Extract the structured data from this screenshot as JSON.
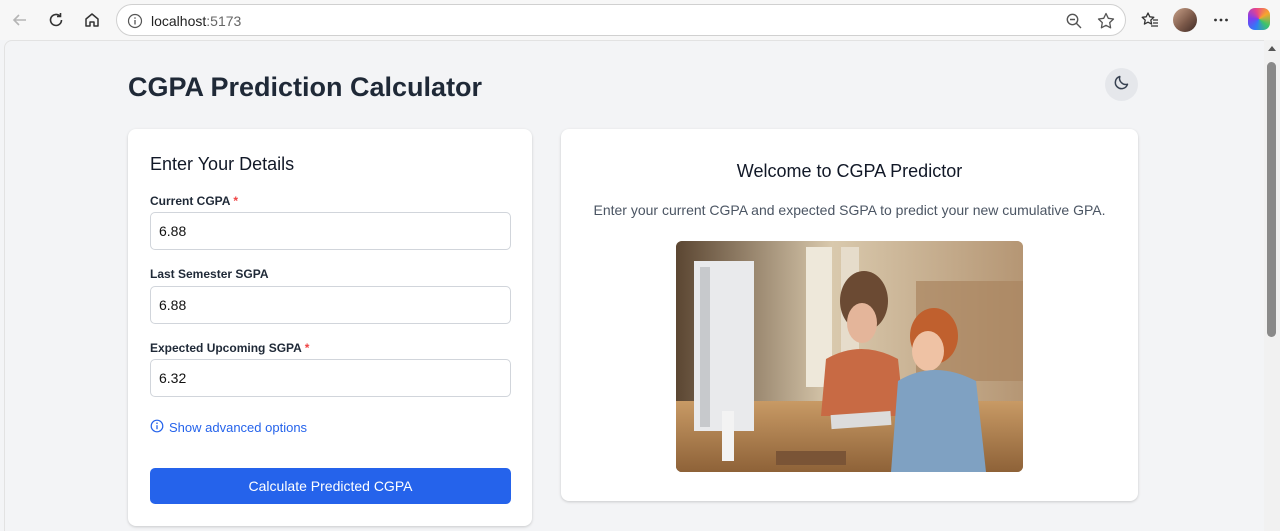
{
  "browser": {
    "url_host": "localhost",
    "url_port": ":5173"
  },
  "page": {
    "title": "CGPA Prediction Calculator"
  },
  "form": {
    "heading": "Enter Your Details",
    "fields": [
      {
        "label": "Current CGPA",
        "required_mark": "*",
        "value": "6.88"
      },
      {
        "label": "Last Semester SGPA",
        "required_mark": "",
        "value": "6.88"
      },
      {
        "label": "Expected Upcoming SGPA",
        "required_mark": "*",
        "value": "6.32"
      }
    ],
    "advanced_link": "Show advanced options",
    "submit_label": "Calculate Predicted CGPA"
  },
  "welcome": {
    "title": "Welcome to CGPA Predictor",
    "text": "Enter your current CGPA and expected SGPA to predict your new cumulative GPA."
  },
  "colors": {
    "accent": "#2563eb",
    "required": "#ef4444",
    "background": "#f3f4f6"
  },
  "icons": [
    "back-icon",
    "refresh-icon",
    "home-icon",
    "info-icon",
    "zoom-icon",
    "star-icon",
    "favorites-icon",
    "more-icon",
    "moon-icon"
  ]
}
